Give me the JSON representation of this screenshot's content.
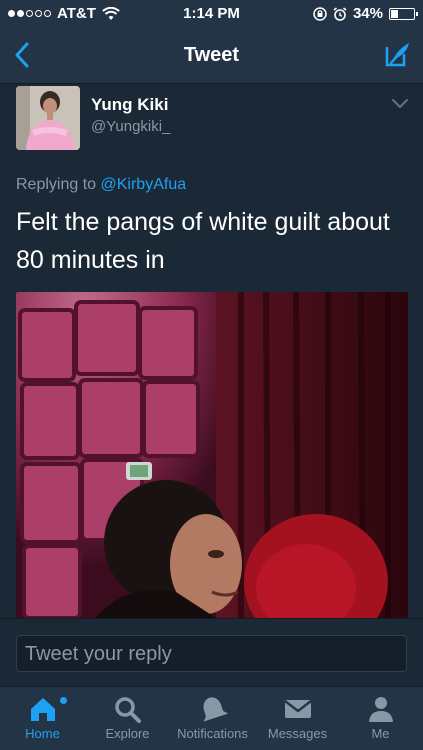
{
  "status_bar": {
    "carrier": "AT&T",
    "time": "1:14 PM",
    "battery_percent": "34%",
    "battery_level": 0.34,
    "signal_bars_filled": 2,
    "signal_bars_total": 5
  },
  "nav": {
    "title": "Tweet",
    "back_icon": "chevron-left-icon",
    "compose_icon": "compose-tweet-icon"
  },
  "tweet": {
    "author_name": "Yung Kiki",
    "author_handle": "@Yungkiki_",
    "replying_prefix": "Replying to",
    "replying_to": "@KirbyAfua",
    "text": "Felt the pangs of white guilt about 80 minutes in"
  },
  "reply": {
    "placeholder": "Tweet your reply"
  },
  "tabs": [
    {
      "label": "Home",
      "icon": "home-icon",
      "active": true
    },
    {
      "label": "Explore",
      "icon": "search-icon",
      "active": false
    },
    {
      "label": "Notifications",
      "icon": "bell-icon",
      "active": false
    },
    {
      "label": "Messages",
      "icon": "envelope-icon",
      "active": false
    },
    {
      "label": "Me",
      "icon": "person-icon",
      "active": false
    }
  ],
  "colors": {
    "background": "#1b2836",
    "bar": "#243447",
    "accent": "#1da1f2",
    "muted": "#8899a6"
  }
}
